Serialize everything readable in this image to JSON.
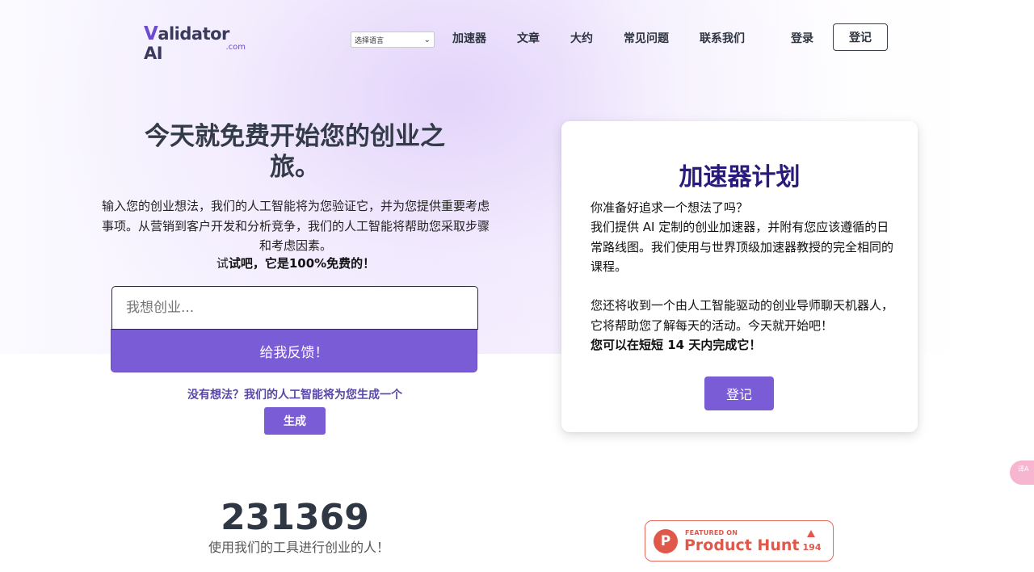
{
  "header": {
    "logo": {
      "prefix": "V",
      "text": "alidator AI",
      "suffix": ".com"
    },
    "language_select": {
      "value": "选择语言",
      "icon": "chevron-down-icon"
    },
    "nav": [
      {
        "label": "加速器"
      },
      {
        "label": "文章"
      },
      {
        "label": "大约"
      },
      {
        "label": "常见问题"
      },
      {
        "label": "联系我们"
      }
    ],
    "login_label": "登录",
    "signup_label": "登记"
  },
  "hero": {
    "title": "今天就免费开始您的创业之旅。",
    "description": "输入您的创业想法，我们的人工智能将为您验证它，并为您提供重要考虑事项。从营销到客户开发和分析竞争，我们的人工智能将帮助您采取步骤和考虑因素。",
    "try_prefix": "试",
    "try_bold": "试吧，它是100%免费的！",
    "input_placeholder": "我想创业...",
    "feedback_button": "给我反馈！",
    "no_idea_text": "没有想法？我们的人工智能将为您生成一个",
    "generate_button": "生成"
  },
  "card": {
    "title": "加速器计划",
    "line1": "你准备好追求一个想法了吗？",
    "line2": "我们提供 AI 定制的创业加速器，并附有您应该遵循的日常路线图。我们使用与世界顶级加速器教授的完全相同的课程。",
    "line3": "您还将收到一个由人工智能驱动的创业导师聊天机器人，它将帮助您了解每天的活动。今天就开始吧！",
    "line4_bold": "您可以在短短 14 天内完成它！",
    "signup_button": "登记"
  },
  "stats": {
    "count": "231369",
    "label": "使用我们的工具进行创业的人！"
  },
  "product_hunt": {
    "featured_on": "FEATURED ON",
    "name": "Product Hunt",
    "logo_letter": "P",
    "upvotes": "194"
  },
  "floating_widget": {
    "label": "译A"
  },
  "colors": {
    "accent": "#7a5cd6",
    "card_title": "#2a1a7a",
    "product_hunt": "#e0584a"
  }
}
